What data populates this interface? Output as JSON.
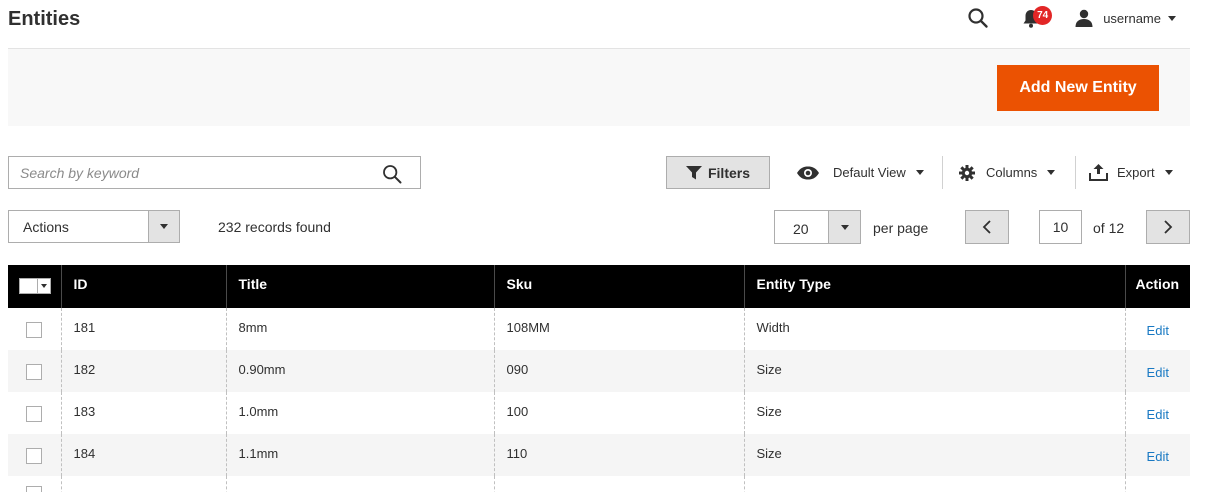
{
  "header": {
    "title": "Entities",
    "notifications_count": "74",
    "username": "username"
  },
  "action_bar": {
    "add_label": "Add New Entity",
    "accent_color": "#eb5202"
  },
  "search": {
    "placeholder": "Search by keyword",
    "value": ""
  },
  "toolbar": {
    "filters_label": "Filters",
    "view_label": "Default View",
    "columns_label": "Columns",
    "export_label": "Export"
  },
  "mass_actions": {
    "label": "Actions"
  },
  "records_found": "232 records found",
  "pager": {
    "per_page_value": "20",
    "per_page_label": "per page",
    "current_page": "10",
    "of_label": "of 12"
  },
  "grid": {
    "columns": [
      "ID",
      "Title",
      "Sku",
      "Entity Type",
      "Action"
    ],
    "rows": [
      {
        "id": "181",
        "title": "8mm",
        "sku": "108MM",
        "entity_type": "Width",
        "action": "Edit"
      },
      {
        "id": "182",
        "title": "0.90mm",
        "sku": "090",
        "entity_type": "Size",
        "action": "Edit"
      },
      {
        "id": "183",
        "title": "1.0mm",
        "sku": "100",
        "entity_type": "Size",
        "action": "Edit"
      },
      {
        "id": "184",
        "title": "1.1mm",
        "sku": "110",
        "entity_type": "Size",
        "action": "Edit"
      }
    ]
  },
  "icons": {
    "search": "search-icon",
    "notifications": "bell-icon",
    "user": "user-icon",
    "filters": "funnel-icon",
    "view": "eye-icon",
    "columns": "gear-icon",
    "export": "export-icon",
    "prev": "chevron-left-icon",
    "next": "chevron-right-icon"
  }
}
